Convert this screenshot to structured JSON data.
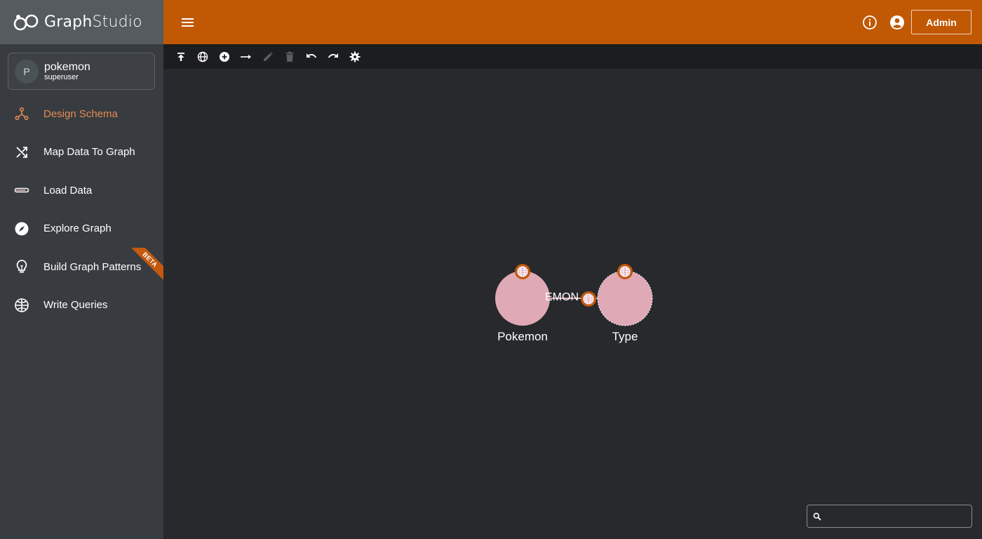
{
  "app": {
    "logo_part1": "Graph",
    "logo_part2": "Studio"
  },
  "user": {
    "initial": "P",
    "name": "pokemon",
    "role": "superuser"
  },
  "nav": {
    "items": [
      {
        "label": "Design Schema",
        "icon": "schema-icon",
        "active": true
      },
      {
        "label": "Map Data To Graph",
        "icon": "shuffle-icon"
      },
      {
        "label": "Load Data",
        "icon": "load-bar-icon"
      },
      {
        "label": "Explore Graph",
        "icon": "compass-icon"
      },
      {
        "label": "Build Graph Patterns",
        "icon": "lightbulb-icon",
        "badge": "BETA"
      },
      {
        "label": "Write Queries",
        "icon": "query-globe-icon"
      }
    ]
  },
  "header": {
    "admin_label": "Admin",
    "icons": [
      "info-icon",
      "account-icon"
    ]
  },
  "toolbar": {
    "buttons": [
      "publish-icon",
      "globe-icon",
      "add-vertex-icon",
      "add-edge-icon",
      "edit-icon",
      "delete-icon",
      "undo-icon",
      "redo-icon",
      "settings-icon"
    ]
  },
  "graph": {
    "nodes": [
      {
        "label": "Pokemon"
      },
      {
        "label": "Type"
      }
    ],
    "edges": [
      {
        "label": "EMON"
      }
    ]
  },
  "search": {
    "placeholder": "",
    "value": ""
  },
  "colors": {
    "header": "#c15904",
    "sidebar": "#383c40",
    "accent_text": "#e58a54",
    "node_fill": "#e0a9b6",
    "badge": "#c4590f"
  }
}
